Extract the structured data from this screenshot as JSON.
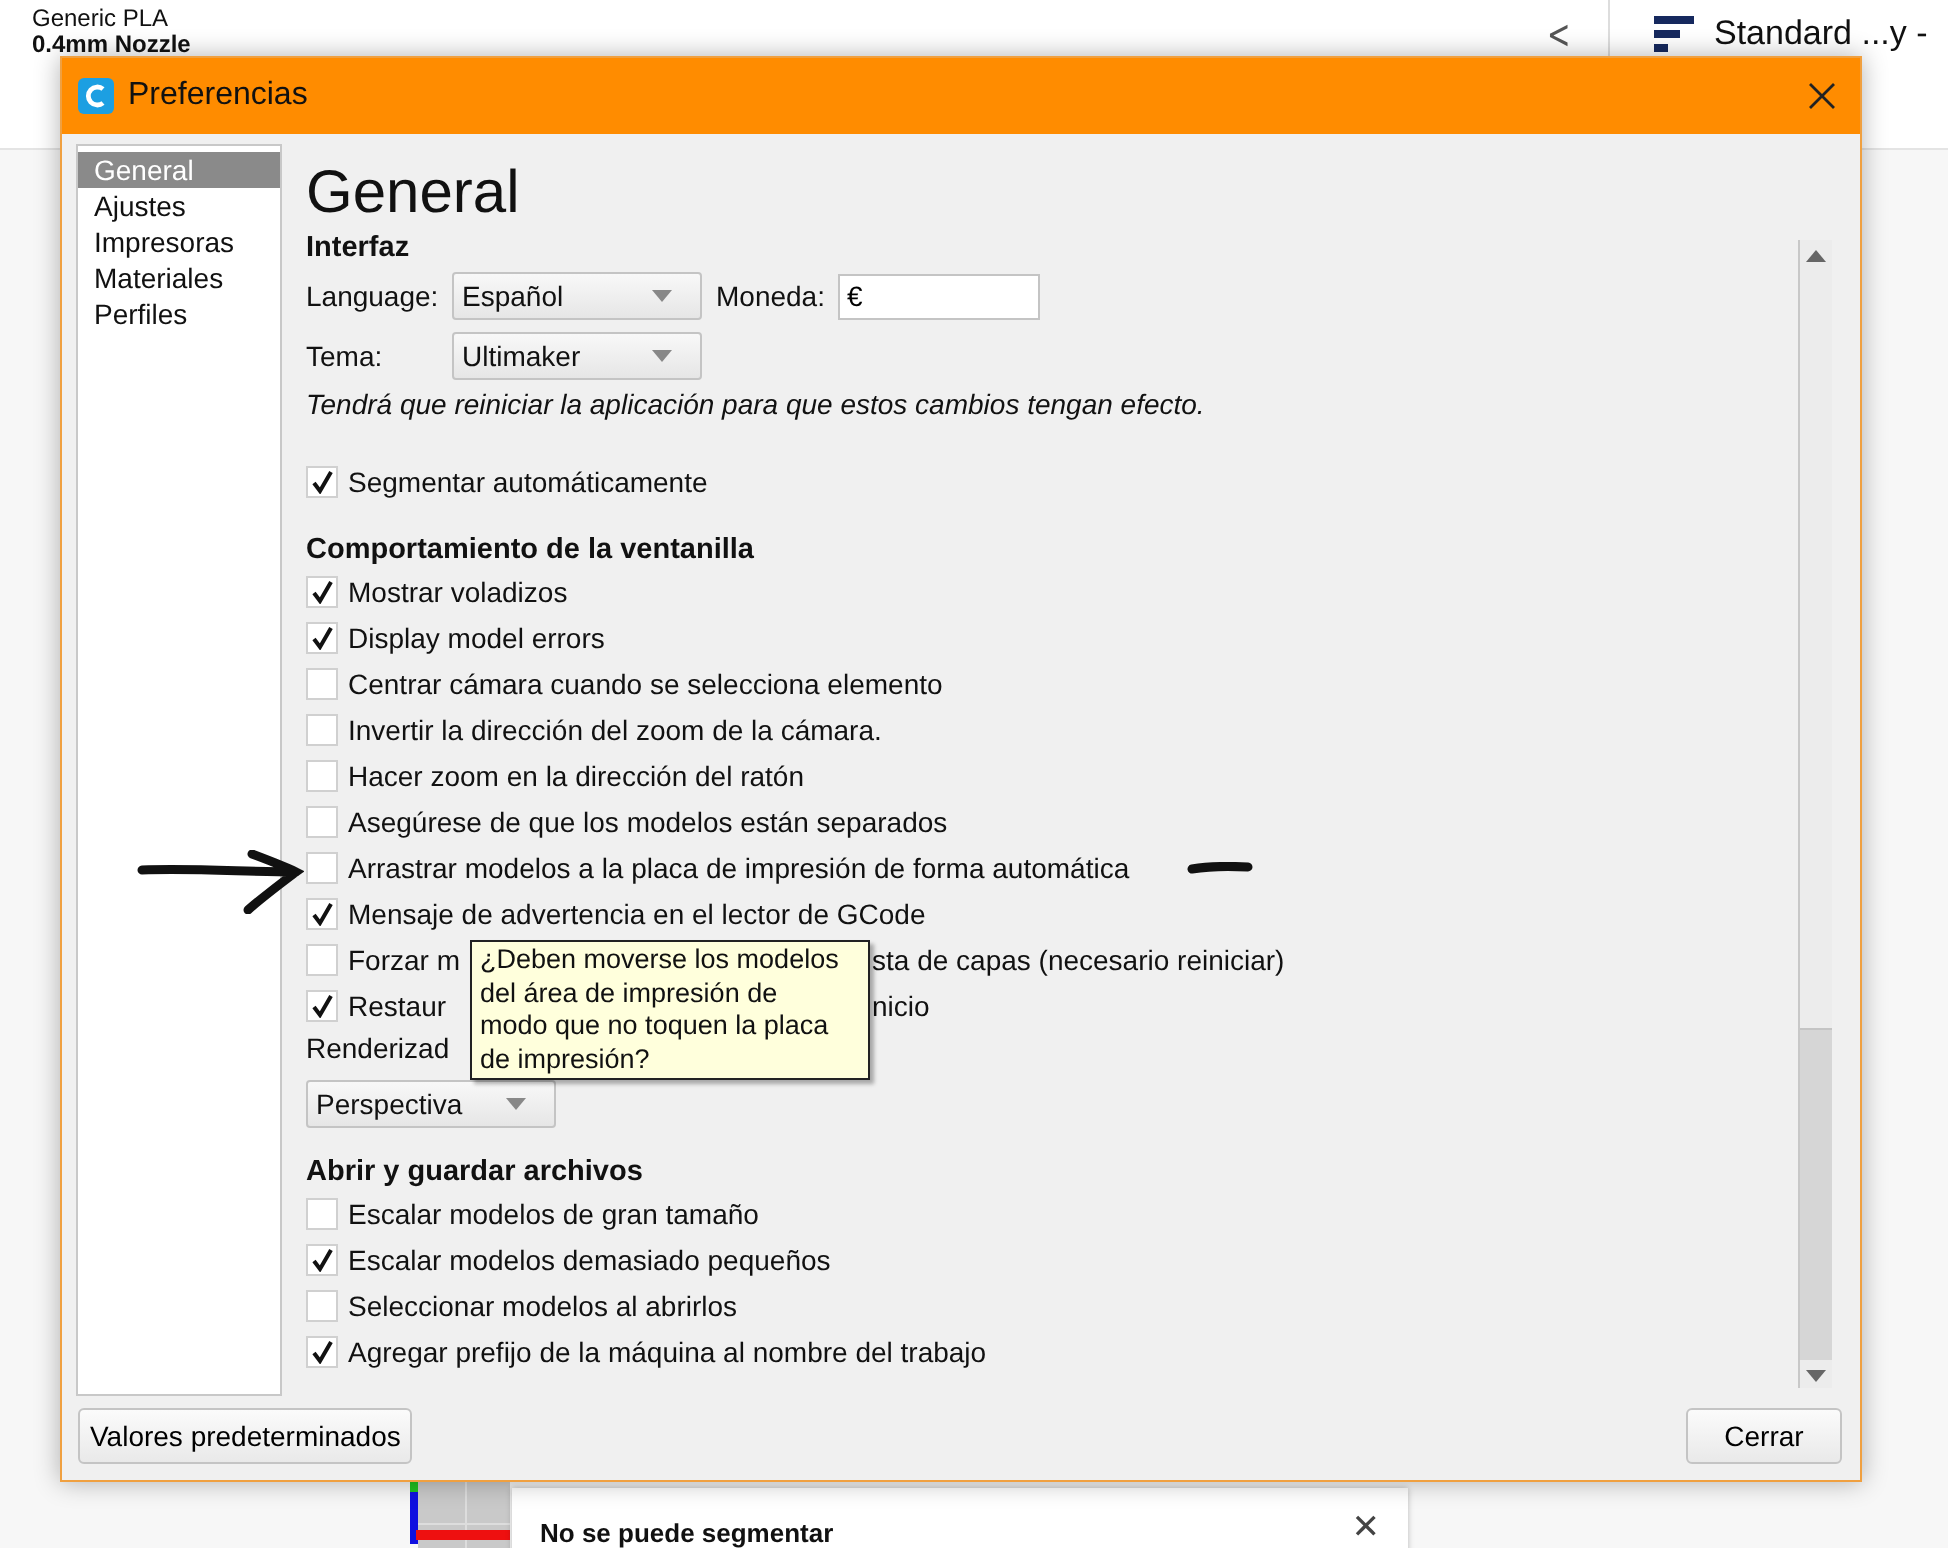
{
  "app_bar": {
    "material": "Generic PLA",
    "nozzle": "0.4mm Nozzle",
    "back": "<",
    "profile": "Standard ...y -"
  },
  "dialog": {
    "title": "Preferencias",
    "sidebar": {
      "items": [
        {
          "label": "General",
          "selected": true
        },
        {
          "label": "Ajustes",
          "selected": false
        },
        {
          "label": "Impresoras",
          "selected": false
        },
        {
          "label": "Materiales",
          "selected": false
        },
        {
          "label": "Perfiles",
          "selected": false
        }
      ]
    },
    "page_title": "General",
    "sections": [
      {
        "heading": "Interfaz",
        "items": [
          {
            "kind": "fields",
            "fields": [
              {
                "kind": "select",
                "label": "Language:",
                "value": "Español"
              },
              {
                "kind": "input",
                "label": "Moneda:",
                "value": "€"
              }
            ]
          },
          {
            "kind": "fields",
            "fields": [
              {
                "kind": "select",
                "label": "Tema:",
                "value": "Ultimaker"
              }
            ]
          },
          {
            "kind": "note",
            "text": "Tendrá que reiniciar la aplicación para que estos cambios tengan efecto."
          }
        ]
      },
      {
        "items": [
          {
            "kind": "checkbox",
            "label": "Segmentar automáticamente",
            "checked": true
          }
        ]
      },
      {
        "heading": "Comportamiento de la ventanilla",
        "items": [
          {
            "kind": "checkbox",
            "label": "Mostrar voladizos",
            "checked": true
          },
          {
            "kind": "checkbox",
            "label": "Display model errors",
            "checked": true
          },
          {
            "kind": "checkbox",
            "label": "Centrar cámara cuando se selecciona elemento",
            "checked": false
          },
          {
            "kind": "checkbox",
            "label": "Invertir la dirección del zoom de la cámara.",
            "checked": false
          },
          {
            "kind": "checkbox",
            "label": "Hacer zoom en la dirección del ratón",
            "checked": false
          },
          {
            "kind": "checkbox",
            "label": "Asegúrese de que los modelos están separados",
            "checked": false
          },
          {
            "kind": "checkbox",
            "label": "Arrastrar modelos a la placa de impresión de forma automática",
            "checked": false
          },
          {
            "kind": "checkbox",
            "label": "Mensaje de advertencia en el lector de GCode",
            "checked": true
          },
          {
            "kind": "checkbox",
            "label": "Forzar m",
            "label_end": "sta de capas (necesario reiniciar)",
            "checked": false
          },
          {
            "kind": "checkbox",
            "label": "Restaur",
            "label_end": "nicio",
            "checked": true
          },
          {
            "kind": "label",
            "text": "Renderizad"
          },
          {
            "kind": "select",
            "value": "Perspectiva"
          }
        ]
      },
      {
        "heading": "Abrir y guardar archivos",
        "items": [
          {
            "kind": "checkbox",
            "label": "Escalar modelos de gran tamaño",
            "checked": false
          },
          {
            "kind": "checkbox",
            "label": "Escalar modelos demasiado pequeños",
            "checked": true
          },
          {
            "kind": "checkbox",
            "label": "Seleccionar modelos al abrirlos",
            "checked": false
          },
          {
            "kind": "checkbox",
            "label": "Agregar prefijo de la máquina al nombre del trabajo",
            "checked": true
          }
        ]
      }
    ],
    "tooltip": "¿Deben moverse los modelos del área de impresión de modo que no toquen la placa de impresión?",
    "buttons": [
      "Valores predeterminados",
      "Cerrar"
    ]
  },
  "notification": {
    "title": "No se puede segmentar",
    "close": "✕"
  }
}
